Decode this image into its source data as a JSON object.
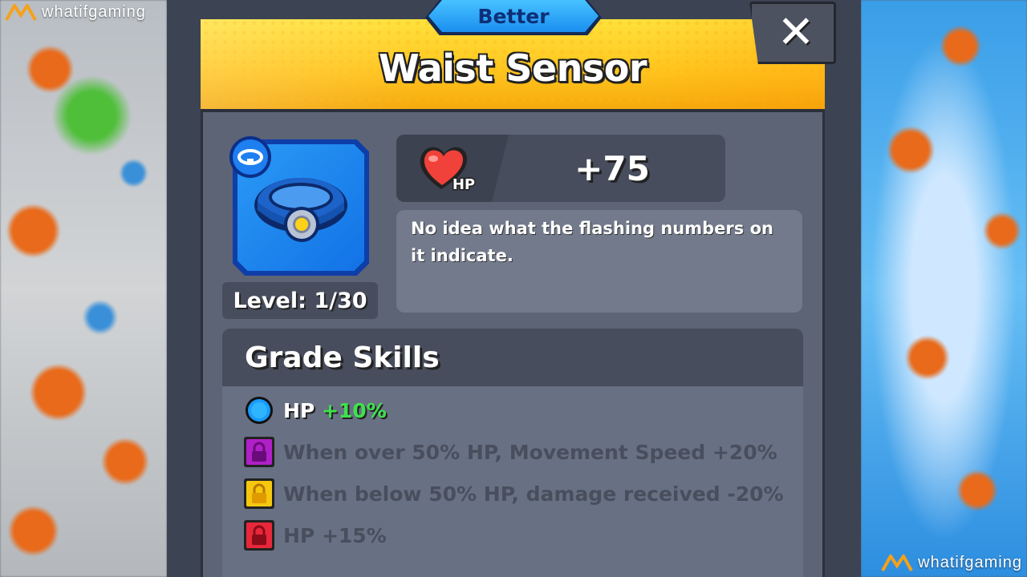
{
  "watermark": {
    "brand": "whatifgaming"
  },
  "header": {
    "grade": "Better",
    "title": "Waist Sensor",
    "close_label": "✕"
  },
  "item": {
    "icon": "belt-icon",
    "type_icon": "belt-type-icon",
    "level_text": "Level: 1/30"
  },
  "stat": {
    "icon": "heart-hp-icon",
    "icon_label": "HP",
    "value": "+75"
  },
  "description": "No idea what the flashing numbers on it indicate.",
  "grade_skills": {
    "heading": "Grade Skills",
    "items": [
      {
        "text": "HP ",
        "bonus": "+10%",
        "status": "unlocked",
        "color": "#1a9bff"
      },
      {
        "text": "When over 50% HP, Movement Speed +20%",
        "status": "locked",
        "color": "#b020c8"
      },
      {
        "text": "When below 50% HP, damage received -20%",
        "status": "locked",
        "color": "#f5c70f"
      },
      {
        "text": "HP +15%",
        "status": "locked",
        "color": "#e8283a"
      }
    ]
  },
  "colors": {
    "banner": "#ffc41d",
    "grade_tag": "#1a8ff0",
    "bonus_green": "#3de24a"
  }
}
